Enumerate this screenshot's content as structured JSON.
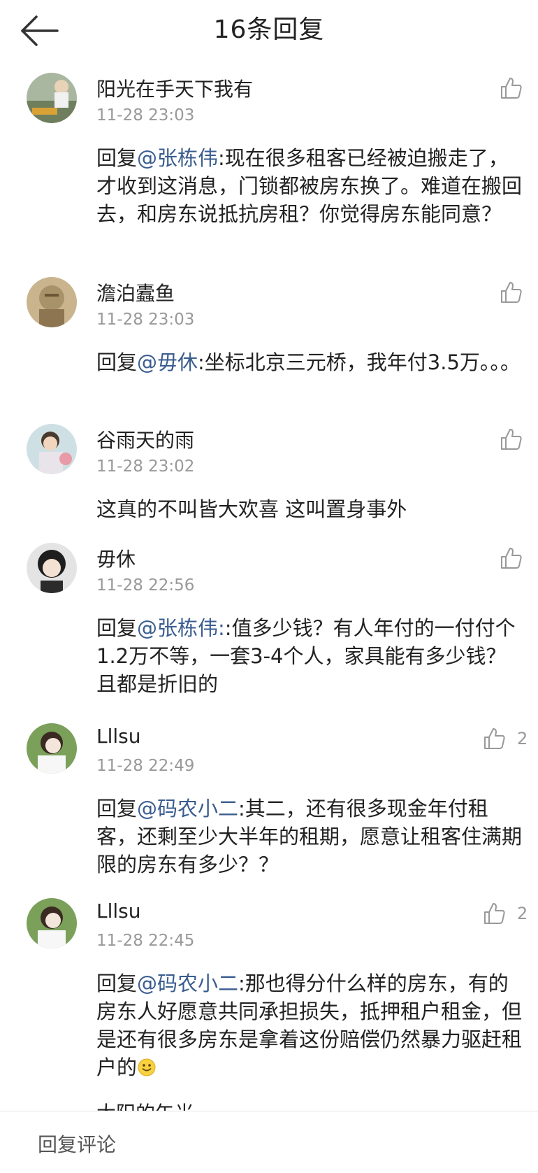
{
  "header": {
    "title": "16条回复"
  },
  "comments": [
    {
      "user": "阳光在手天下我有",
      "time": "11-28 23:03",
      "prefix": "回复",
      "mention": "@张栋伟",
      "text": ":现在很多租客已经被迫搬走了，才收到这消息，门锁都被房东换了。难道在搬回去，和房东说抵抗房租？你觉得房东能同意？",
      "likes": ""
    },
    {
      "user": "澹泊蠹鱼",
      "time": "11-28 23:03",
      "prefix": "回复",
      "mention": "@毋休",
      "text": ":坐标北京三元桥，我年付3.5万。。。",
      "likes": ""
    },
    {
      "user": "谷雨天的雨",
      "time": "11-28 23:02",
      "prefix": "",
      "mention": "",
      "text": "这真的不叫皆大欢喜 这叫置身事外",
      "likes": ""
    },
    {
      "user": "毋休",
      "time": "11-28 22:56",
      "prefix": "回复",
      "mention": "@张栋伟:",
      "text": ":值多少钱？有人年付的一付付个1.2万不等，一套3-4个人，家具能有多少钱？且都是折旧的",
      "likes": ""
    },
    {
      "user": "Lllsu",
      "time": "11-28 22:49",
      "prefix": "回复",
      "mention": "@码农小二",
      "text": ":其二，还有很多现金年付租客，还剩至少大半年的租期，愿意让租客住满期限的房东有多少？？",
      "likes": "2"
    },
    {
      "user": "Lllsu",
      "time": "11-28 22:45",
      "prefix": "回复",
      "mention": "@码农小二",
      "text": ":那也得分什么样的房东，有的房东人好愿意共同承担损失，抵押租户租金，但是还有很多房东是拿着这份赔偿仍然暴力驱赶租户的",
      "likes": "2"
    }
  ],
  "peek_user": "大阳的午光",
  "reply_bar": {
    "placeholder": "回复评论"
  },
  "icons": {
    "back": "arrow-left-icon",
    "like": "thumbs-up-icon",
    "emoji": "smile-emoji-icon"
  }
}
